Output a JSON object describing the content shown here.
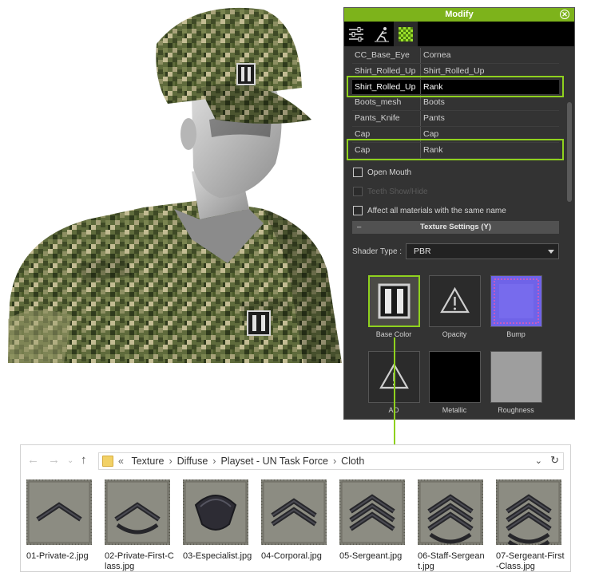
{
  "panel": {
    "title": "Modify",
    "close_icon": "close-circle-icon",
    "tabs": [
      {
        "name": "sliders-icon"
      },
      {
        "name": "pose-icon"
      },
      {
        "name": "material-checker-icon",
        "active": true
      }
    ],
    "materials": [
      {
        "object": "CC_Base_Eye",
        "material": "Cornea",
        "selected": false
      },
      {
        "object": "Shirt_Rolled_Up",
        "material": "Shirt_Rolled_Up",
        "selected": false
      },
      {
        "object": "Shirt_Rolled_Up",
        "material": "Rank",
        "selected": true
      },
      {
        "object": "Boots_mesh",
        "material": "Boots",
        "selected": false
      },
      {
        "object": "Pants_Knife",
        "material": "Pants",
        "selected": false
      },
      {
        "object": "Cap",
        "material": "Cap",
        "selected": false
      },
      {
        "object": "Cap",
        "material": "Rank",
        "selected": false
      }
    ],
    "open_mouth": "Open Mouth",
    "teeth_toggle": "Teeth Show/Hide",
    "affect_all": "Affect all materials with the same name",
    "texture_settings": "Texture Settings  (Y)",
    "shader_label": "Shader Type :",
    "shader_value": "PBR",
    "slots": [
      "Base Color",
      "Opacity",
      "Bump",
      "AO",
      "Metallic",
      "Roughness"
    ],
    "accent": "#8fd11e"
  },
  "explorer": {
    "breadcrumbs": [
      "Texture",
      "Diffuse",
      "Playset - UN Task Force",
      "Cloth"
    ],
    "files": [
      {
        "name": "01-Private-2.jpg",
        "chevrons": 1,
        "rockers": 0,
        "style": "chevron"
      },
      {
        "name": "02-Private-First-Class.jpg",
        "chevrons": 1,
        "rockers": 1,
        "style": "chevron"
      },
      {
        "name": "03-Especialist.jpg",
        "chevrons": 0,
        "rockers": 0,
        "style": "specialist"
      },
      {
        "name": "04-Corporal.jpg",
        "chevrons": 2,
        "rockers": 0,
        "style": "chevron"
      },
      {
        "name": "05-Sergeant.jpg",
        "chevrons": 3,
        "rockers": 0,
        "style": "chevron"
      },
      {
        "name": "06-Staff-Sergeant.jpg",
        "chevrons": 3,
        "rockers": 1,
        "style": "chevron"
      },
      {
        "name": "07-Sergeant-First-Class.jpg",
        "chevrons": 3,
        "rockers": 2,
        "style": "chevron"
      }
    ]
  }
}
